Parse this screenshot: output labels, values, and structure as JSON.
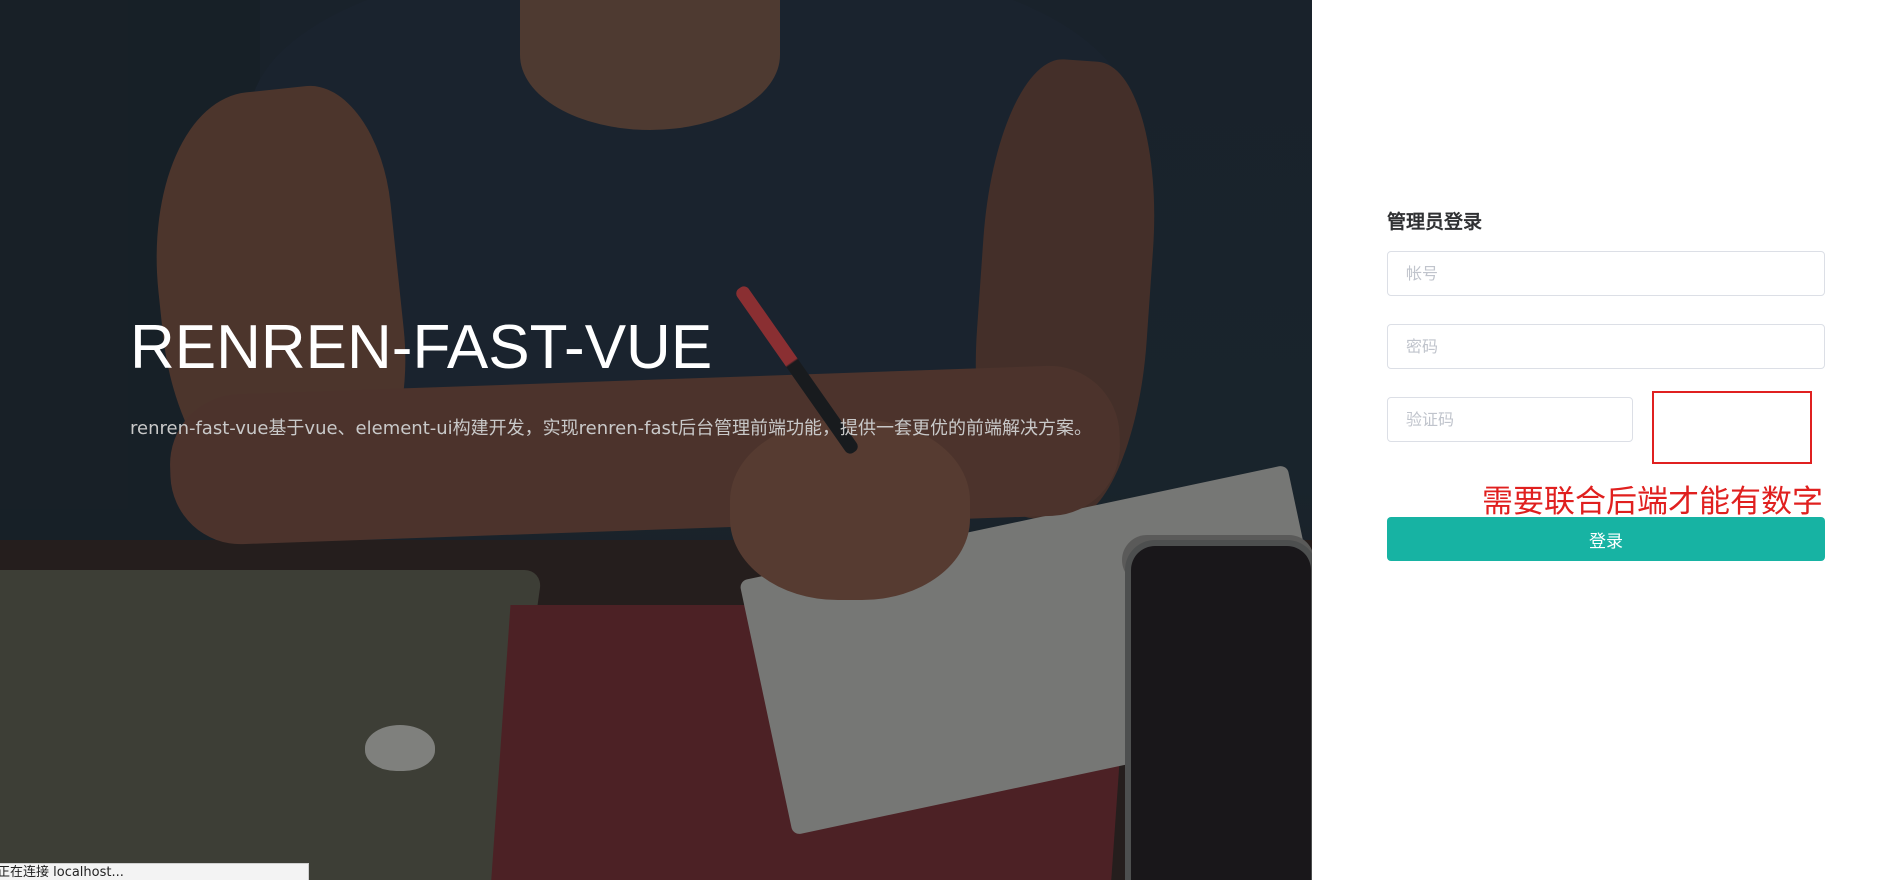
{
  "hero": {
    "title": "RENREN-FAST-VUE",
    "description": "renren-fast-vue基于vue、element-ui构建开发，实现renren-fast后台管理前端功能，提供一套更优的前端解决方案。"
  },
  "status_bar": {
    "text": "正在连接 localhost..."
  },
  "login": {
    "title": "管理员登录",
    "username_placeholder": "帐号",
    "password_placeholder": "密码",
    "captcha_placeholder": "验证码",
    "captcha_annotation": "需要联合后端才能有数字",
    "submit_label": "登录",
    "colors": {
      "button": "#17b3a3",
      "annotation": "#e0201f"
    }
  }
}
